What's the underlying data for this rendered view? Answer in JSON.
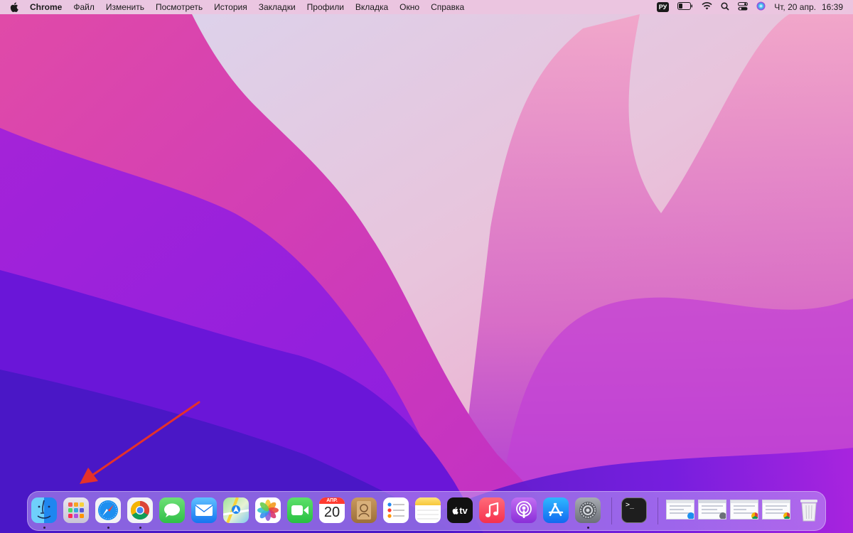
{
  "menubar": {
    "app_name": "Chrome",
    "menus": [
      "Файл",
      "Изменить",
      "Посмотреть",
      "История",
      "Закладки",
      "Профили",
      "Вкладка",
      "Окно",
      "Справка"
    ],
    "input_source": "РУ",
    "clock_date": "Чт, 20 апр.",
    "clock_time": "16:39"
  },
  "dock": {
    "apps": [
      {
        "name": "Finder",
        "icon": "finder-icon",
        "running": true
      },
      {
        "name": "Launchpad",
        "icon": "launchpad-icon",
        "running": false
      },
      {
        "name": "Safari",
        "icon": "safari-icon",
        "running": true
      },
      {
        "name": "Google Chrome",
        "icon": "chrome-icon",
        "running": true
      },
      {
        "name": "Messages",
        "icon": "messages-icon",
        "running": false
      },
      {
        "name": "Mail",
        "icon": "mail-icon",
        "running": false
      },
      {
        "name": "Maps",
        "icon": "maps-icon",
        "running": false
      },
      {
        "name": "Photos",
        "icon": "photos-icon",
        "running": false
      },
      {
        "name": "FaceTime",
        "icon": "facetime-icon",
        "running": false
      },
      {
        "name": "Calendar",
        "icon": "calendar-icon",
        "running": false
      },
      {
        "name": "Contacts",
        "icon": "contacts-icon",
        "running": false
      },
      {
        "name": "Reminders",
        "icon": "reminders-icon",
        "running": false
      },
      {
        "name": "Notes",
        "icon": "notes-icon",
        "running": false
      },
      {
        "name": "TV",
        "icon": "tv-icon",
        "running": false
      },
      {
        "name": "Music",
        "icon": "music-icon",
        "running": false
      },
      {
        "name": "Podcasts",
        "icon": "podcasts-icon",
        "running": false
      },
      {
        "name": "App Store",
        "icon": "appstore-icon",
        "running": false
      },
      {
        "name": "System Settings",
        "icon": "settings-icon",
        "running": true
      },
      {
        "name": "Terminal",
        "icon": "terminal-icon",
        "running": false
      }
    ],
    "calendar_month": "АПР.",
    "calendar_day": "20",
    "tv_label": "tv",
    "terminal_prompt": ">_",
    "minimized_windows": [
      {
        "icon": "safari-badge-icon"
      },
      {
        "icon": "settings-badge-icon"
      },
      {
        "icon": "chrome-badge-icon"
      },
      {
        "icon": "chrome-badge-icon"
      }
    ]
  },
  "colors": {
    "arrow": "#e5312a",
    "menubar_bg": "#ecc4e0"
  }
}
